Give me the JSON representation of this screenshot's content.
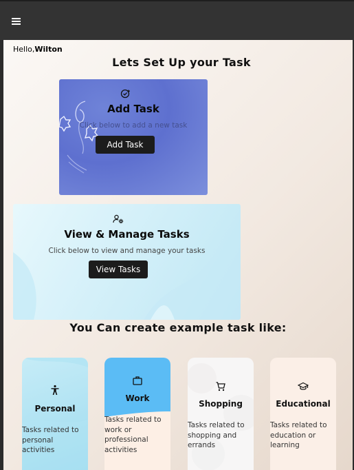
{
  "topbar": {
    "menu_icon": "hamburger-menu-icon"
  },
  "greeting": {
    "prefix": "Hello,",
    "name": "Wilton"
  },
  "setup_heading": "Lets Set Up your Task",
  "add_card": {
    "icon": "add-task-icon",
    "title": "Add Task",
    "subtitle": "Click below to add a new task",
    "button": "Add Task"
  },
  "view_card": {
    "icon": "manage-tasks-icon",
    "title": "View & Manage Tasks",
    "subtitle": "Click below to view and manage your tasks",
    "button": "View Tasks"
  },
  "examples_heading": "You Can create example task like:",
  "examples": [
    {
      "icon": "accessibility-person-icon",
      "title": "Personal",
      "desc": "Tasks related to personal activities"
    },
    {
      "icon": "briefcase-icon",
      "title": "Work",
      "desc": "Tasks related to work or professional activities"
    },
    {
      "icon": "shopping-cart-icon",
      "title": "Shopping",
      "desc": "Tasks related to shopping and errands"
    },
    {
      "icon": "graduation-cap-icon",
      "title": "Educational",
      "desc": "Tasks related to education or learning"
    }
  ],
  "colors": {
    "topbar": "#333333",
    "button_bg": "#1c1c1c",
    "add_card_bg": "#5e70cf",
    "view_card_bg": "#d4f0f9",
    "work_card_top": "#5bbcf5"
  }
}
